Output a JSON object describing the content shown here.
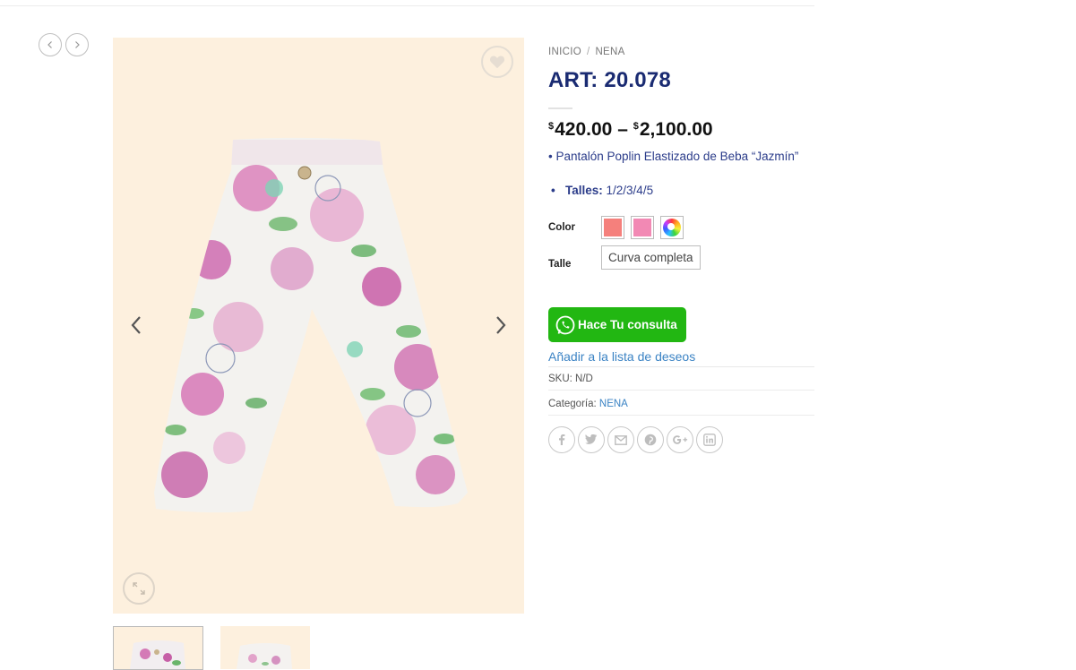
{
  "breadcrumb": {
    "home": "INICIO",
    "separator": "/",
    "category": "NENA"
  },
  "product": {
    "title": "ART: 20.078",
    "price_min_currency": "$",
    "price_min": "420.00",
    "price_dash": "–",
    "price_max_currency": "$",
    "price_max": "2,100.00",
    "description": "• Pantalón Poplin Elastizado de Beba “Jazmín”",
    "talles_bullet": "•",
    "talles_label": "Talles:",
    "talles_value": "1/2/3/4/5"
  },
  "variations": {
    "color_label": "Color",
    "colors": [
      "#f5807c",
      "#f289b4",
      "multicolor"
    ],
    "talle_label": "Talle",
    "talle_value": "Curva completa"
  },
  "actions": {
    "whatsapp_label": "Hace Tu consulta",
    "wishlist_label": "Añadir a la lista de deseos"
  },
  "meta": {
    "sku_label": "SKU:",
    "sku_value": "N/D",
    "category_label": "Categoría:",
    "category_value": "NENA"
  },
  "share_icons": [
    "facebook-icon",
    "twitter-icon",
    "email-icon",
    "pinterest-icon",
    "google-plus-icon",
    "linkedin-icon"
  ],
  "colors": {
    "title": "#1a2b72",
    "link": "#3b83c4",
    "whatsapp": "#22b712",
    "gallery_bg": "#fdf0de"
  }
}
